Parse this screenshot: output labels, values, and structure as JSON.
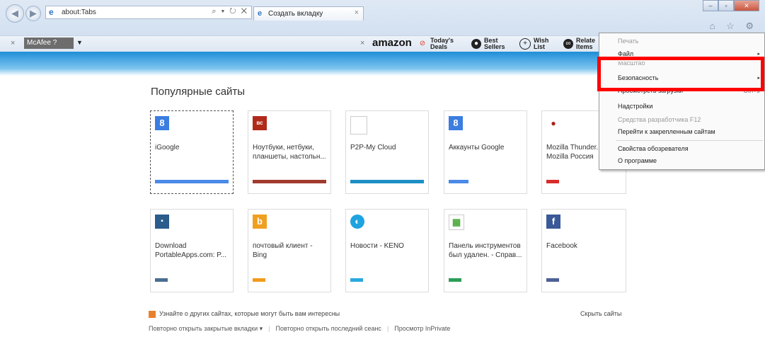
{
  "browser": {
    "address": "about:Tabs",
    "address_buttons": "⌕ ▾ ↻ ✕",
    "tab_title": "Создать вкладку",
    "tab_close": "×",
    "top_icons": "⌂ ☆ ⚙"
  },
  "toolbar": {
    "mcafee": "McAfee",
    "amazon": "amazon",
    "items": [
      {
        "label": "Today's\nDeals",
        "icon": "deals-icon",
        "color": "#e23b2a"
      },
      {
        "label": "Best\nSellers",
        "icon": "best-sellers-icon",
        "color": "#222222"
      },
      {
        "label": "Wish\nList",
        "icon": "wish-list-icon",
        "color": "#222222"
      },
      {
        "label": "Relate\nItems",
        "icon": "related-items-icon",
        "color": "#222222"
      }
    ]
  },
  "page": {
    "title": "Популярные сайты",
    "tiles": [
      {
        "label": "iGoogle",
        "icon": "google-icon",
        "icon_text": "8",
        "icon_color": "#3b7de0",
        "bar_color": "#4a89e8"
      },
      {
        "label": "Ноутбуки, нетбуки, планшеты, настольн...",
        "icon": "store-icon",
        "icon_text": "вс",
        "icon_color": "#b02a1a",
        "bar_color": "#a23a2e"
      },
      {
        "label": "P2P-My Cloud",
        "icon": "blank-icon",
        "icon_text": "",
        "icon_color": "#ffffff",
        "bar_color": "#1e8fc4"
      },
      {
        "label": "Аккаунты Google",
        "icon": "google-icon",
        "icon_text": "8",
        "icon_color": "#3b7de0",
        "bar_color": "#4a89e8"
      },
      {
        "label": "Mozilla Thunder... Mozilla Россия",
        "icon": "mozilla-icon",
        "icon_text": "●",
        "icon_color": "#b01c1c",
        "bar_color": "#d92b2b"
      },
      {
        "label": "Download PortableApps.com: P...",
        "icon": "portableapps-icon",
        "icon_text": "▪",
        "icon_color": "#2a5c8c",
        "bar_color": "#4a6e91"
      },
      {
        "label": "почтовый клиент - Bing",
        "icon": "bing-icon",
        "icon_text": "b",
        "icon_color": "#f0a020",
        "bar_color": "#f29b1c"
      },
      {
        "label": "Новости - KENO",
        "icon": "keno-icon",
        "icon_text": "◐",
        "icon_color": "#1ea3e0",
        "bar_color": "#2aa9e0"
      },
      {
        "label": "Панель инструментов был удален. - Справ...",
        "icon": "toolbar-removed-icon",
        "icon_text": "▦",
        "icon_color": "#4caa3c",
        "bar_color": "#2e9e58"
      },
      {
        "label": "Facebook",
        "icon": "facebook-icon",
        "icon_text": "f",
        "icon_color": "#3b5998",
        "bar_color": "#4d6096"
      }
    ],
    "discover": "Узнайте о других сайтах, которые могут быть вам интересны",
    "hide_sites": "Скрыть сайты",
    "reopen_closed": "Повторно открыть закрытые вкладки ▾",
    "reopen_session": "Повторно открыть последний сеанс",
    "inprivate": "Просмотр InPrivate"
  },
  "menu": {
    "items": [
      {
        "label": "Печать",
        "disabled": true
      },
      {
        "label": "Файл",
        "disabled": false,
        "arrow": "▸"
      },
      {
        "label": "Масштаб",
        "disabled": true
      },
      {
        "label": "Безопасность",
        "disabled": false,
        "arrow": "▸"
      },
      {
        "label": "Просмотреть загрузки",
        "disabled": false,
        "shortcut": "Ctrl+J"
      },
      {
        "label": "Надстройки",
        "disabled": false
      },
      {
        "label": "Средства разработчика F12",
        "disabled": true
      },
      {
        "label": "Перейти к закрепленным сайтам",
        "disabled": false
      },
      {
        "label": "Свойства обозревателя",
        "disabled": false
      },
      {
        "label": "О программе",
        "disabled": false
      }
    ]
  }
}
